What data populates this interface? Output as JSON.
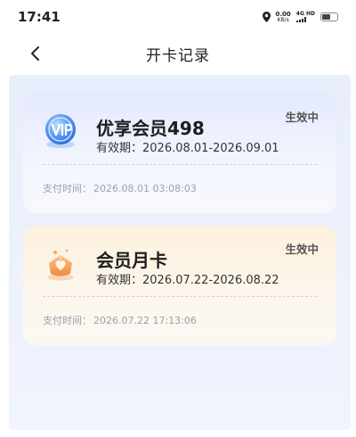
{
  "status_bar": {
    "time": "17:41",
    "net_speed_value": "0.00",
    "net_speed_unit": "KB/s",
    "signal_tag": "4G HD",
    "icons": [
      "location-icon",
      "signal-icon",
      "battery-icon"
    ]
  },
  "nav": {
    "title": "开卡记录",
    "back_icon": "chevron-left-icon"
  },
  "records": [
    {
      "name": "优享会员498",
      "validity_label": "有效期：",
      "validity_range": "2026.08.01-2026.09.01",
      "status": "生效中",
      "paytime_label": "支付时间：",
      "paytime_value": "2026.08.01 03:08:03",
      "icon": "vip-badge-icon",
      "accent_color": "#4f8df5"
    },
    {
      "name": "会员月卡",
      "validity_label": "有效期：",
      "validity_range": "2026.07.22-2026.08.22",
      "status": "生效中",
      "paytime_label": "支付时间：",
      "paytime_value": "2026.07.22 17:13:06",
      "icon": "heart-gift-icon",
      "accent_color": "#f39a55"
    }
  ]
}
